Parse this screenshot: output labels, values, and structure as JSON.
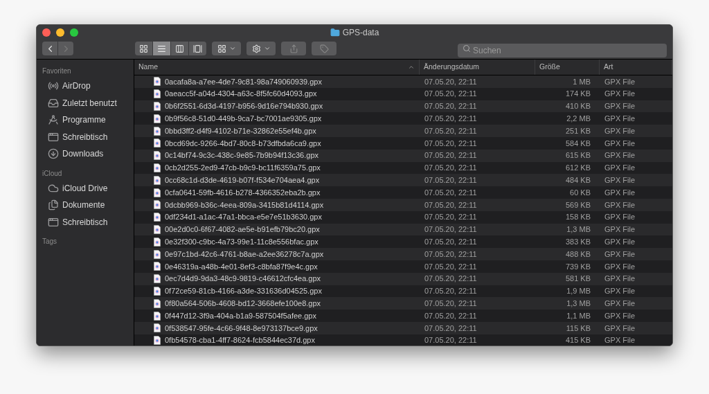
{
  "window": {
    "title": "GPS-data"
  },
  "toolbar": {
    "back": {
      "disabled": false
    },
    "forward": {
      "disabled": true
    },
    "view_modes": [
      {
        "kind": "icons",
        "selected": false
      },
      {
        "kind": "list",
        "selected": true
      },
      {
        "kind": "columns",
        "selected": false
      },
      {
        "kind": "gallery",
        "selected": false
      }
    ],
    "share": {
      "disabled": true
    },
    "tags": {
      "disabled": true
    },
    "search": {
      "placeholder": "Suchen"
    }
  },
  "sidebar": {
    "sections": [
      {
        "title": "Favoriten",
        "items": [
          {
            "label": "AirDrop",
            "kind": "airdrop"
          },
          {
            "label": "Zuletzt benutzt",
            "kind": "recent"
          },
          {
            "label": "Programme",
            "kind": "apps"
          },
          {
            "label": "Schreibtisch",
            "kind": "desktop"
          },
          {
            "label": "Downloads",
            "kind": "downloads"
          }
        ]
      },
      {
        "title": "iCloud",
        "items": [
          {
            "label": "iCloud Drive",
            "kind": "cloud"
          },
          {
            "label": "Dokumente",
            "kind": "documents"
          },
          {
            "label": "Schreibtisch",
            "kind": "desktop"
          }
        ]
      },
      {
        "title": "Tags"
      }
    ]
  },
  "table": {
    "columns": [
      {
        "label": "Name",
        "sorted": true
      },
      {
        "label": "Änderungsdatum",
        "sorted": false
      },
      {
        "label": "Größe",
        "sorted": false
      },
      {
        "label": "Art",
        "sorted": false
      }
    ],
    "rows": [
      {
        "name": "0acafa8a-a7ee-4de7-9c81-98a749060939.gpx",
        "modified": "07.05.20, 22:11",
        "size": "1 MB",
        "type": "GPX File"
      },
      {
        "name": "0aeacc5f-a04d-4304-a63c-8f5fc60d4093.gpx",
        "modified": "07.05.20, 22:11",
        "size": "174 KB",
        "type": "GPX File"
      },
      {
        "name": "0b6f2551-6d3d-4197-b956-9d16e794b930.gpx",
        "modified": "07.05.20, 22:11",
        "size": "410 KB",
        "type": "GPX File"
      },
      {
        "name": "0b9f56c8-51d0-449b-9ca7-bc7001ae9305.gpx",
        "modified": "07.05.20, 22:11",
        "size": "2,2 MB",
        "type": "GPX File"
      },
      {
        "name": "0bbd3ff2-d4f9-4102-b71e-32862e55ef4b.gpx",
        "modified": "07.05.20, 22:11",
        "size": "251 KB",
        "type": "GPX File"
      },
      {
        "name": "0bcd69dc-9266-4bd7-80c8-b73dfbda6ca9.gpx",
        "modified": "07.05.20, 22:11",
        "size": "584 KB",
        "type": "GPX File"
      },
      {
        "name": "0c14bf74-9c3c-438c-9e85-7b9b94f13c36.gpx",
        "modified": "07.05.20, 22:11",
        "size": "615 KB",
        "type": "GPX File"
      },
      {
        "name": "0cb2d255-2ed9-47cb-b9c9-bc11f6359a75.gpx",
        "modified": "07.05.20, 22:11",
        "size": "612 KB",
        "type": "GPX File"
      },
      {
        "name": "0cc68c1d-d3de-4619-b07f-f534e704aea4.gpx",
        "modified": "07.05.20, 22:11",
        "size": "484 KB",
        "type": "GPX File"
      },
      {
        "name": "0cfa0641-59fb-4616-b278-4366352eba2b.gpx",
        "modified": "07.05.20, 22:11",
        "size": "60 KB",
        "type": "GPX File"
      },
      {
        "name": "0dcbb969-b36c-4eea-809a-3415b81d4114.gpx",
        "modified": "07.05.20, 22:11",
        "size": "569 KB",
        "type": "GPX File"
      },
      {
        "name": "0df234d1-a1ac-47a1-bbca-e5e7e51b3630.gpx",
        "modified": "07.05.20, 22:11",
        "size": "158 KB",
        "type": "GPX File"
      },
      {
        "name": "00e2d0c0-6f67-4082-ae5e-b91efb79bc20.gpx",
        "modified": "07.05.20, 22:11",
        "size": "1,3 MB",
        "type": "GPX File"
      },
      {
        "name": "0e32f300-c9bc-4a73-99e1-11c8e556bfac.gpx",
        "modified": "07.05.20, 22:11",
        "size": "383 KB",
        "type": "GPX File"
      },
      {
        "name": "0e97c1bd-42c6-4761-b8ae-a2ee36278c7a.gpx",
        "modified": "07.05.20, 22:11",
        "size": "488 KB",
        "type": "GPX File"
      },
      {
        "name": "0e46319a-a48b-4e01-8ef3-c8bfa87f9e4c.gpx",
        "modified": "07.05.20, 22:11",
        "size": "739 KB",
        "type": "GPX File"
      },
      {
        "name": "0ec7d4d9-9da3-48c9-9819-c46612cfc4ea.gpx",
        "modified": "07.05.20, 22:11",
        "size": "581 KB",
        "type": "GPX File"
      },
      {
        "name": "0f72ce59-81cb-4166-a3de-331636d04525.gpx",
        "modified": "07.05.20, 22:11",
        "size": "1,9 MB",
        "type": "GPX File"
      },
      {
        "name": "0f80a564-506b-4608-bd12-3668efe100e8.gpx",
        "modified": "07.05.20, 22:11",
        "size": "1,3 MB",
        "type": "GPX File"
      },
      {
        "name": "0f447d12-3f9a-404a-b1a9-587504f5afee.gpx",
        "modified": "07.05.20, 22:11",
        "size": "1,1 MB",
        "type": "GPX File"
      },
      {
        "name": "0f538547-95fe-4c66-9f48-8e973137bce9.gpx",
        "modified": "07.05.20, 22:11",
        "size": "115 KB",
        "type": "GPX File"
      },
      {
        "name": "0fb54578-cba1-4ff7-8624-fcb5844ec37d.gpx",
        "modified": "07.05.20, 22:11",
        "size": "415 KB",
        "type": "GPX File"
      }
    ]
  }
}
